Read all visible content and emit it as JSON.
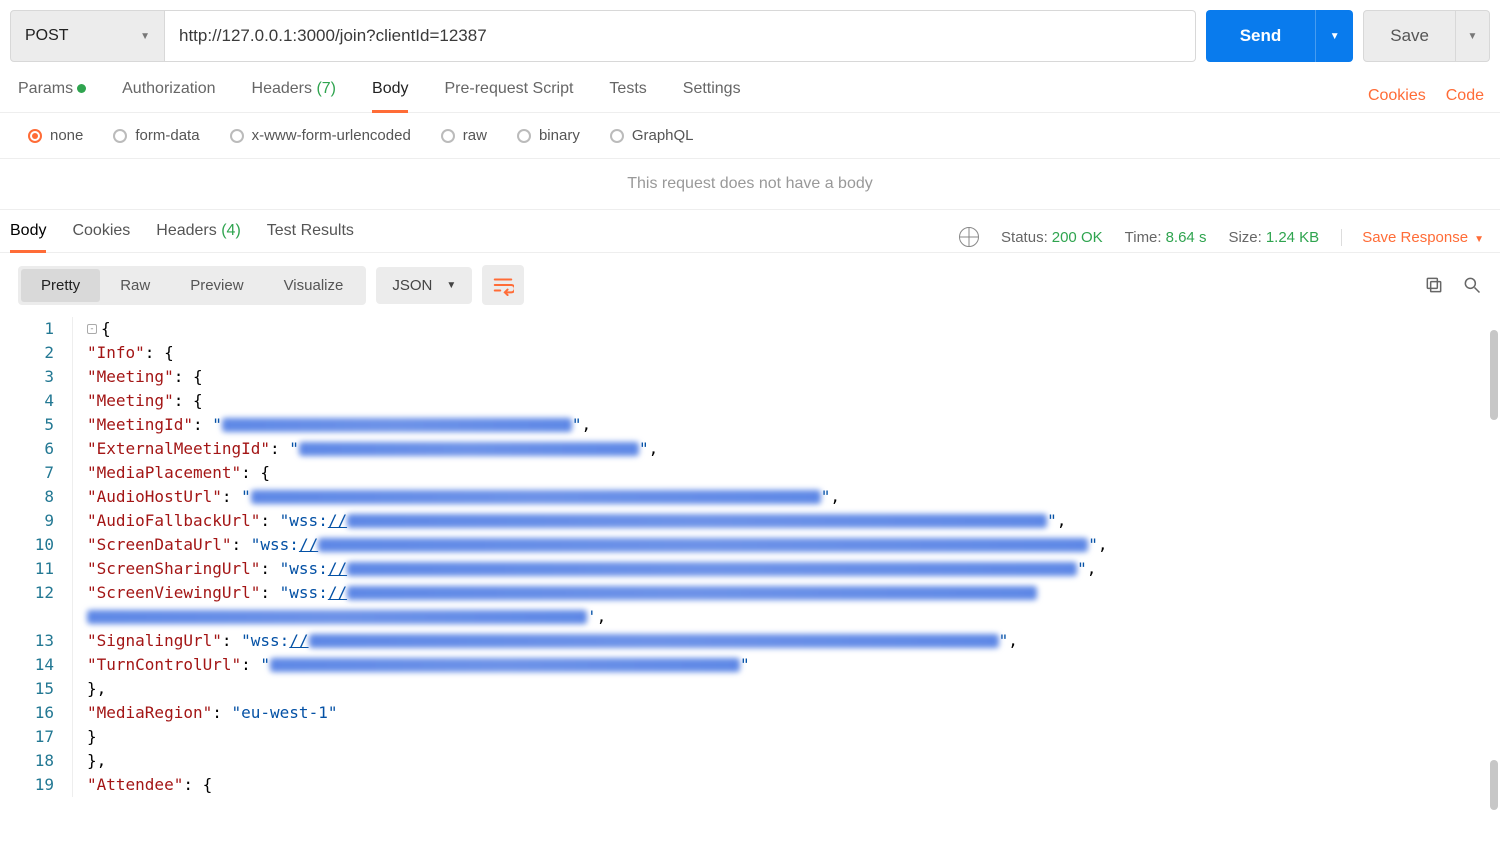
{
  "request": {
    "method": "POST",
    "url": "http://127.0.0.1:3000/join?clientId=12387",
    "send_label": "Send",
    "save_label": "Save"
  },
  "req_tabs": {
    "params": "Params",
    "authorization": "Authorization",
    "headers": "Headers",
    "headers_count": "(7)",
    "body": "Body",
    "prerequest": "Pre-request Script",
    "tests": "Tests",
    "settings": "Settings"
  },
  "right_links": {
    "cookies": "Cookies",
    "code": "Code"
  },
  "body_types": {
    "none": "none",
    "formdata": "form-data",
    "xwww": "x-www-form-urlencoded",
    "raw": "raw",
    "binary": "binary",
    "graphql": "GraphQL"
  },
  "no_body_msg": "This request does not have a body",
  "res_tabs": {
    "body": "Body",
    "cookies": "Cookies",
    "headers": "Headers",
    "headers_count": "(4)",
    "test_results": "Test Results"
  },
  "res_meta": {
    "status_label": "Status:",
    "status_val": "200 OK",
    "time_label": "Time:",
    "time_val": "8.64 s",
    "size_label": "Size:",
    "size_val": "1.24 KB",
    "save_response": "Save Response"
  },
  "viewer": {
    "pretty": "Pretty",
    "raw": "Raw",
    "preview": "Preview",
    "visualize": "Visualize",
    "format": "JSON"
  },
  "json_body": {
    "Info": {
      "Meeting": {
        "Meeting": {
          "MeetingId": "[redacted]",
          "ExternalMeetingId": "[redacted]",
          "MediaPlacement": {
            "AudioHostUrl": "[redacted]",
            "AudioFallbackUrl": "wss://[redacted]",
            "ScreenDataUrl": "wss://[redacted]",
            "ScreenSharingUrl": "wss://[redacted]",
            "ScreenViewingUrl": "wss://[redacted]",
            "SignalingUrl": "wss://[redacted]",
            "TurnControlUrl": "[redacted]"
          },
          "MediaRegion": "eu-west-1"
        }
      },
      "Attendee": {}
    }
  },
  "line_numbers": [
    "1",
    "2",
    "3",
    "4",
    "5",
    "6",
    "7",
    "8",
    "9",
    "10",
    "11",
    "12",
    "",
    "13",
    "14",
    "15",
    "16",
    "17",
    "18",
    "19"
  ]
}
